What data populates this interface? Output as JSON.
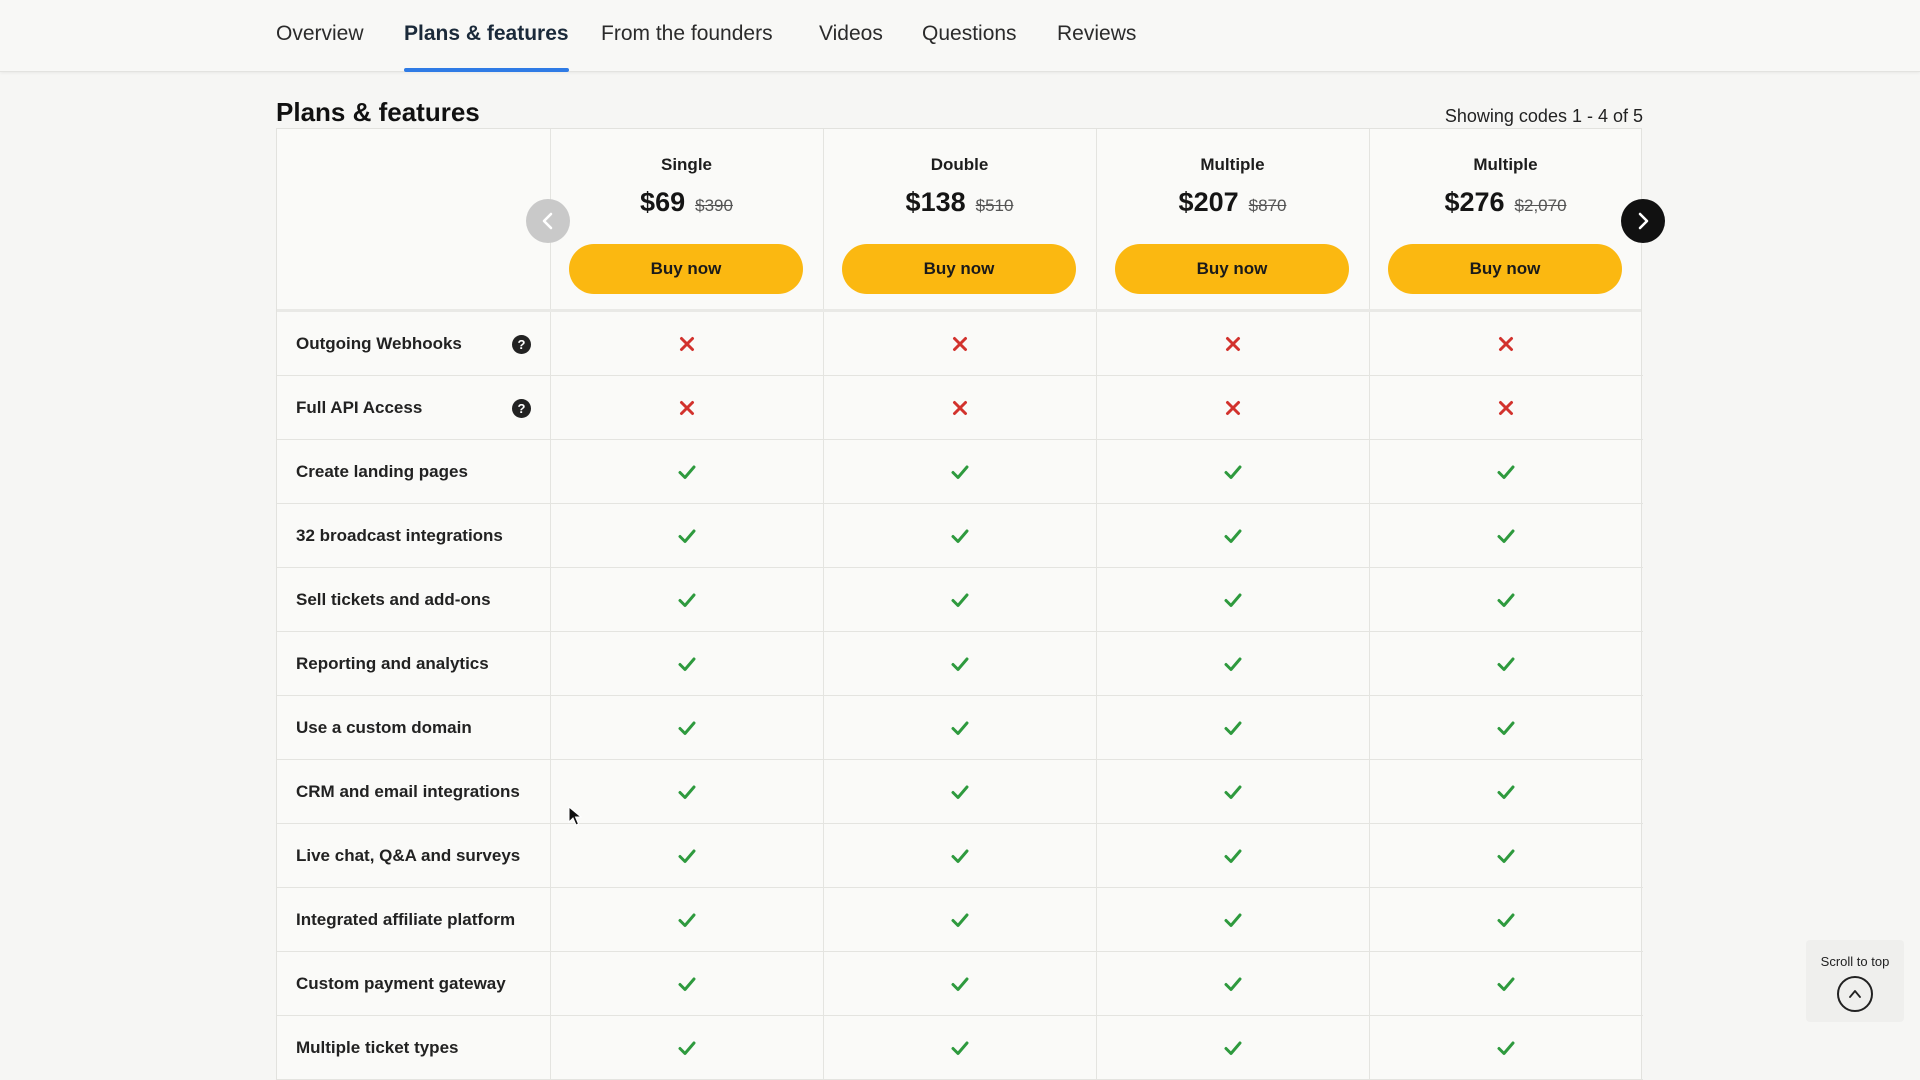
{
  "nav": {
    "tabs": [
      {
        "label": "Overview"
      },
      {
        "label": "Plans & features"
      },
      {
        "label": "From the founders"
      },
      {
        "label": "Videos"
      },
      {
        "label": "Questions"
      },
      {
        "label": "Reviews"
      }
    ],
    "active": "Plans & features"
  },
  "section": {
    "title": "Plans & features",
    "showing": "Showing codes 1 - 4 of 5"
  },
  "plans": [
    {
      "name": "Single",
      "price": "$69",
      "old_price": "$390",
      "buy_label": "Buy now"
    },
    {
      "name": "Double",
      "price": "$138",
      "old_price": "$510",
      "buy_label": "Buy now"
    },
    {
      "name": "Multiple",
      "price": "$207",
      "old_price": "$870",
      "buy_label": "Buy now"
    },
    {
      "name": "Multiple",
      "price": "$276",
      "old_price": "$2,070",
      "buy_label": "Buy now"
    }
  ],
  "carousel": {
    "prev_icon": "chevron-left-icon",
    "next_icon": "chevron-right-icon"
  },
  "features": [
    {
      "label": "Outgoing Webhooks",
      "help": true,
      "values": [
        false,
        false,
        false,
        false
      ]
    },
    {
      "label": "Full API Access",
      "help": true,
      "values": [
        false,
        false,
        false,
        false
      ]
    },
    {
      "label": "Create landing pages",
      "help": false,
      "values": [
        true,
        true,
        true,
        true
      ]
    },
    {
      "label": "32 broadcast integrations",
      "help": false,
      "values": [
        true,
        true,
        true,
        true
      ]
    },
    {
      "label": "Sell tickets and add-ons",
      "help": false,
      "values": [
        true,
        true,
        true,
        true
      ]
    },
    {
      "label": "Reporting and analytics",
      "help": false,
      "values": [
        true,
        true,
        true,
        true
      ]
    },
    {
      "label": "Use a custom domain",
      "help": false,
      "values": [
        true,
        true,
        true,
        true
      ]
    },
    {
      "label": "CRM and email integrations",
      "help": false,
      "values": [
        true,
        true,
        true,
        true
      ]
    },
    {
      "label": "Live chat, Q&A and surveys",
      "help": false,
      "values": [
        true,
        true,
        true,
        true
      ]
    },
    {
      "label": "Integrated affiliate platform",
      "help": false,
      "values": [
        true,
        true,
        true,
        true
      ]
    },
    {
      "label": "Custom payment gateway",
      "help": false,
      "values": [
        true,
        true,
        true,
        true
      ]
    },
    {
      "label": "Multiple ticket types",
      "help": false,
      "values": [
        true,
        true,
        true,
        true
      ]
    }
  ],
  "help_glyph": "?",
  "scroll_top": {
    "label": "Scroll to top"
  },
  "colors": {
    "accent": "#2f7be5",
    "buy_button": "#fbb811",
    "check": "#2e9a3e",
    "cross": "#d2322d"
  }
}
